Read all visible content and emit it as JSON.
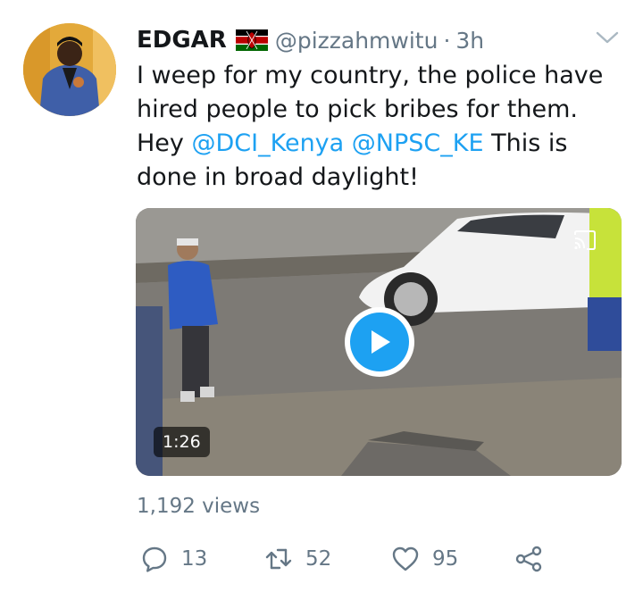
{
  "tweet": {
    "author_name": "EDGAR",
    "handle": "@pizzahmwitu",
    "separator": "·",
    "time": "3h",
    "text_part1": "I weep for my country, the police have hired people to pick bribes for them. Hey ",
    "mention1": "@DCI_Kenya",
    "text_part2": " ",
    "mention2": "@NPSC_KE",
    "text_part3": " This is done in broad daylight!",
    "video_duration": "1:26",
    "views": "1,192 views"
  },
  "actions": {
    "replies": "13",
    "retweets": "52",
    "likes": "95"
  },
  "icons": {
    "flag": "kenya-flag-icon",
    "menu": "chevron-down-icon",
    "reply": "reply-icon",
    "retweet": "retweet-icon",
    "like": "heart-icon",
    "share": "share-icon",
    "play": "play-icon",
    "cast": "cast-icon"
  },
  "colors": {
    "accent": "#1da1f2",
    "secondary_text": "#657786",
    "primary_text": "#14171a"
  }
}
